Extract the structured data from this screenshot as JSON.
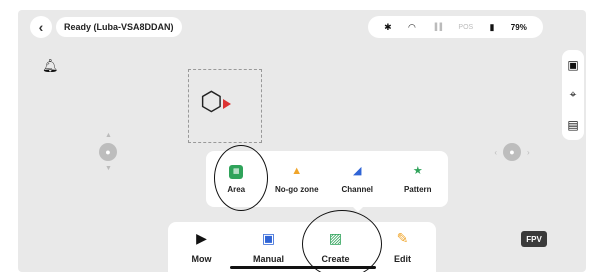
{
  "header": {
    "status_text": "Ready (Luba-VSA8DDAN)",
    "battery_text": "79%",
    "pos_label": "POS"
  },
  "popup": {
    "items": [
      {
        "label": "Area",
        "icon": "area-icon"
      },
      {
        "label": "No-go zone",
        "icon": "cone-icon"
      },
      {
        "label": "Channel",
        "icon": "road-icon"
      },
      {
        "label": "Pattern",
        "icon": "star-icon"
      }
    ]
  },
  "bottom_bar": {
    "items": [
      {
        "label": "Mow",
        "icon": "play-icon"
      },
      {
        "label": "Manual",
        "icon": "gamepad-icon"
      },
      {
        "label": "Create",
        "icon": "create-map-icon"
      },
      {
        "label": "Edit",
        "icon": "edit-icon"
      }
    ]
  },
  "fpv_label": "FPV",
  "colors": {
    "accent_green": "#2fa35a",
    "accent_blue": "#2f64d6",
    "accent_orange": "#f0a52a"
  }
}
